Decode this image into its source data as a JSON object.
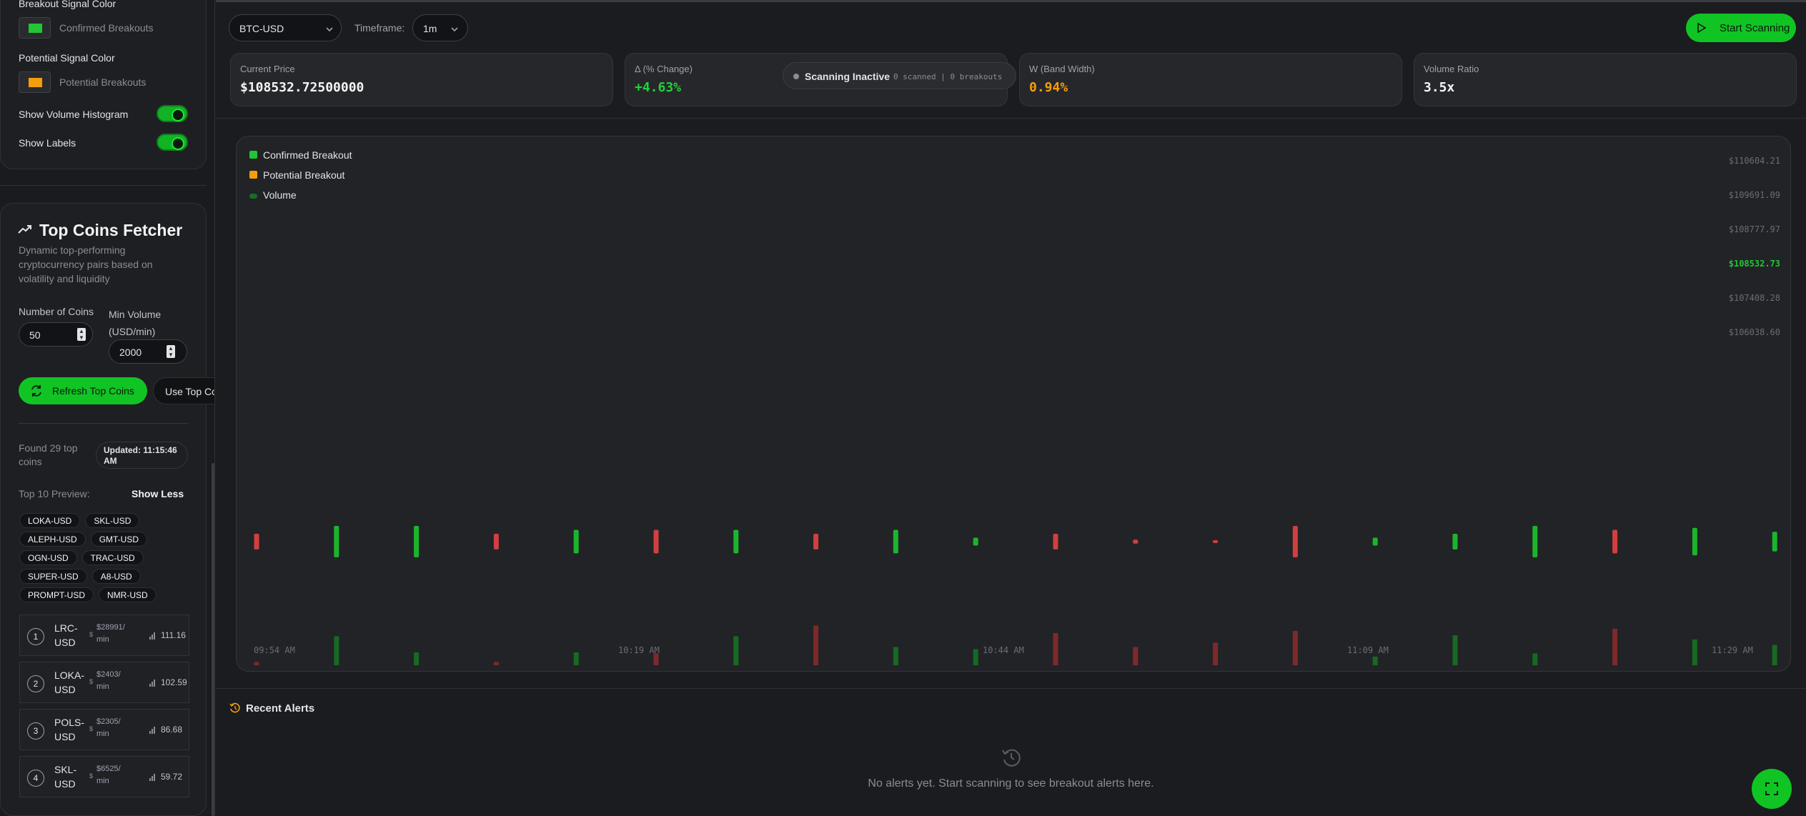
{
  "sidebar": {
    "breakout_signal_label": "Breakout Signal Color",
    "confirmed_label": "Confirmed Breakouts",
    "potential_signal_label": "Potential Signal Color",
    "potential_label": "Potential Breakouts",
    "show_volume_label": "Show Volume Histogram",
    "show_labels_label": "Show Labels",
    "colors": {
      "confirmed": "#22c534",
      "potential": "#f59e0b"
    }
  },
  "fetcher": {
    "title": "Top Coins Fetcher",
    "description": "Dynamic top-performing cryptocurrency pairs based on volatility and liquidity",
    "num_coins_label": "Number of Coins",
    "num_coins_value": "50",
    "min_volume_label": "Min Volume (USD/min)",
    "min_volume_value": "2000",
    "refresh_button": "Refresh Top Coins",
    "use_button": "Use Top Coi",
    "found_text": "Found 29 top coins",
    "updated_text": "Updated: 11:15:46 AM",
    "preview_label": "Top 10 Preview:",
    "show_less": "Show Less",
    "chips": [
      "LOKA-USD",
      "SKL-USD",
      "ALEPH-USD",
      "GMT-USD",
      "OGN-USD",
      "TRAC-USD",
      "SUPER-USD",
      "A8-USD",
      "PROMPT-USD",
      "NMR-USD"
    ],
    "coins": [
      {
        "rank": "1",
        "symbol": "LRC-USD",
        "volume": "$28991/ min",
        "score": "111.16"
      },
      {
        "rank": "2",
        "symbol": "LOKA-USD",
        "volume": "$2403/ min",
        "score": "102.59"
      },
      {
        "rank": "3",
        "symbol": "POLS-USD",
        "volume": "$2305/ min",
        "score": "86.68"
      },
      {
        "rank": "4",
        "symbol": "SKL-USD",
        "volume": "$6525/ min",
        "score": "59.72"
      }
    ]
  },
  "toolbar": {
    "symbol": "BTC-USD",
    "timeframe_label": "Timeframe:",
    "timeframe": "1m",
    "start_button": "Start Scanning"
  },
  "stats": {
    "price_label": "Current Price",
    "price_value": "$108532.72500000",
    "change_label": "Δ (% Change)",
    "change_value": "+4.63%",
    "band_label": "W (Band Width)",
    "band_value": "0.94%",
    "volume_label": "Volume Ratio",
    "volume_value": "3.5x",
    "scan_status": "Scanning Inactive",
    "scan_counts": "0 scanned | 0 breakouts"
  },
  "chart_data": {
    "type": "bar",
    "legend": [
      "Confirmed Breakout",
      "Potential Breakout",
      "Volume"
    ],
    "y_tick_labels": [
      "$110604.21",
      "$109691.09",
      "$108777.97",
      "$108532.73",
      "$107408.28",
      "$106038.60"
    ],
    "x_tick_labels": [
      "09:54 AM",
      "10:19 AM",
      "10:44 AM",
      "11:09 AM",
      "11:29 AM"
    ],
    "candles": [
      {
        "dir": "down",
        "size": 2
      },
      {
        "dir": "up",
        "size": 4
      },
      {
        "dir": "up",
        "size": 4
      },
      {
        "dir": "down",
        "size": 2
      },
      {
        "dir": "up",
        "size": 3
      },
      {
        "dir": "down",
        "size": 3
      },
      {
        "dir": "up",
        "size": 3
      },
      {
        "dir": "down",
        "size": 2
      },
      {
        "dir": "up",
        "size": 3
      },
      {
        "dir": "up",
        "size": 1
      },
      {
        "dir": "down",
        "size": 2
      },
      {
        "dir": "down",
        "size": 0.5
      },
      {
        "dir": "down",
        "size": 0.3
      },
      {
        "dir": "down",
        "size": 4
      },
      {
        "dir": "up",
        "size": 1
      },
      {
        "dir": "up",
        "size": 2
      },
      {
        "dir": "up",
        "size": 4
      },
      {
        "dir": "down",
        "size": 3
      },
      {
        "dir": "up",
        "size": 3.5
      },
      {
        "dir": "up",
        "size": 2.5
      }
    ],
    "volumes": [
      0.3,
      2.7,
      1.2,
      0.3,
      1.2,
      1.1,
      2.7,
      3.7,
      1.7,
      1.5,
      3.0,
      1.7,
      2.1,
      3.2,
      0.8,
      2.8,
      1.1,
      3.4,
      2.4,
      1.9
    ]
  },
  "alerts": {
    "title": "Recent Alerts",
    "empty_text": "No alerts yet. Start scanning to see breakout alerts here."
  }
}
